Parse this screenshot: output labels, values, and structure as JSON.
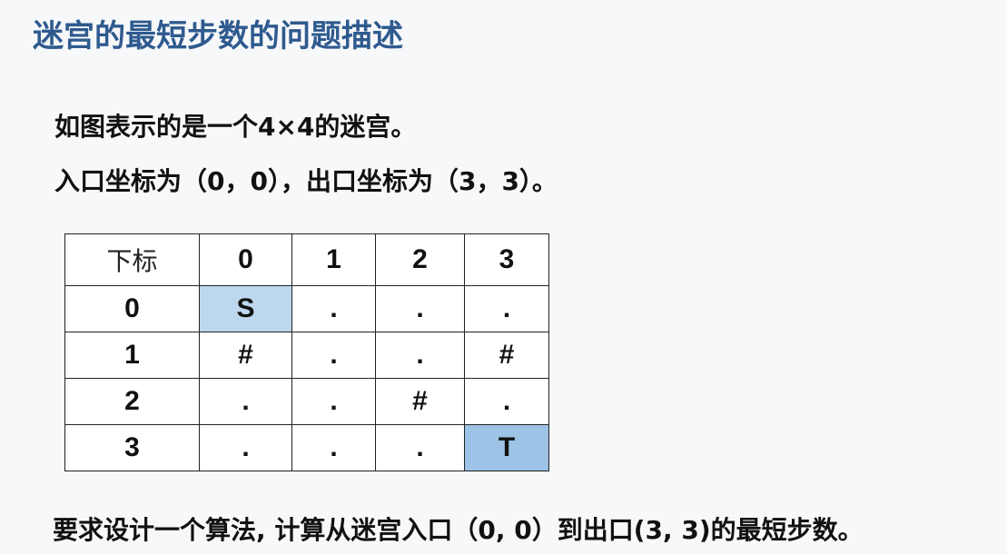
{
  "title": "迷宫的最短步数的问题描述",
  "intro": {
    "line1": "如图表示的是一个4×4的迷宫。",
    "line2": "入口坐标为（0，0），出口坐标为（3，3）。"
  },
  "table": {
    "corner_label": "下标",
    "col_headers": [
      "0",
      "1",
      "2",
      "3"
    ],
    "rows": [
      {
        "label": "0",
        "cells": [
          "S",
          ".",
          ".",
          "."
        ]
      },
      {
        "label": "1",
        "cells": [
          "#",
          ".",
          ".",
          "#"
        ]
      },
      {
        "label": "2",
        "cells": [
          ".",
          ".",
          "#",
          "."
        ]
      },
      {
        "label": "3",
        "cells": [
          ".",
          ".",
          ".",
          "T"
        ]
      }
    ],
    "colors": {
      "start_cell": "#bdd7ee",
      "target_cell": "#9dc3e6"
    }
  },
  "task": "要求设计一个算法, 计算从迷宫入口（0, 0）到出口(3, 3)的最短步数。",
  "colors": {
    "title": "#2e5a8e",
    "background": "#f7f8fa"
  }
}
